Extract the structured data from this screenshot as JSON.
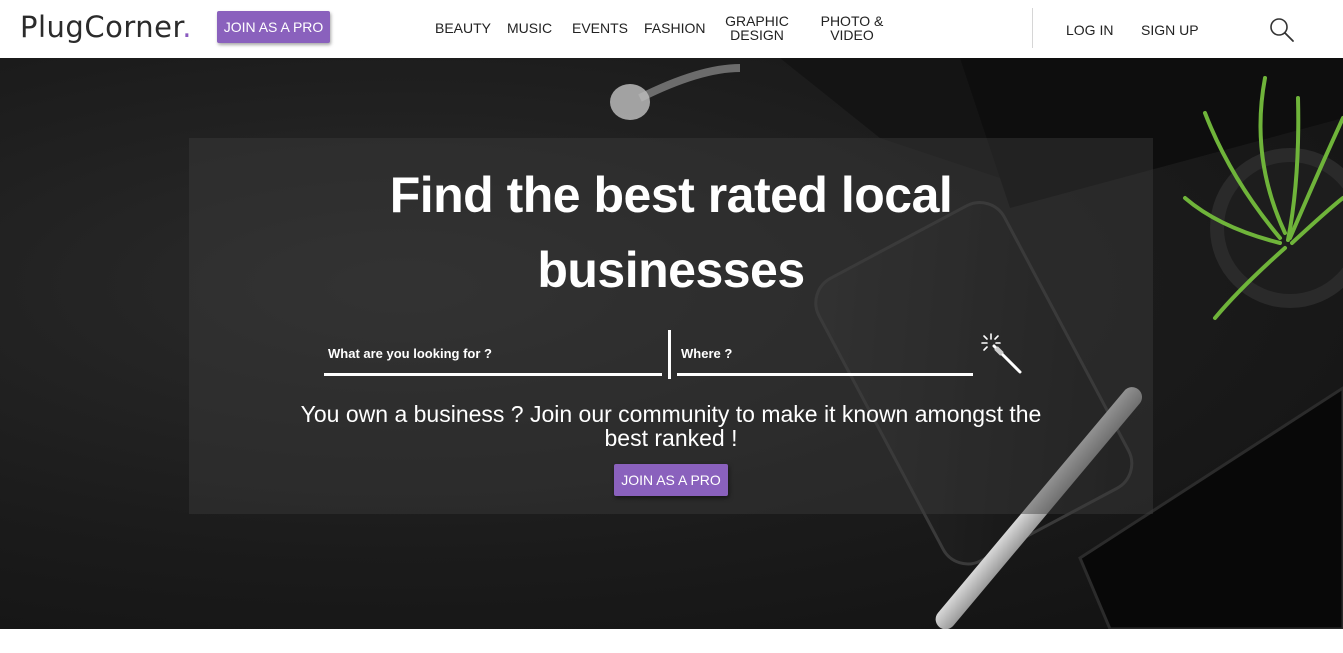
{
  "header": {
    "logo_text": "PlugCorner",
    "logo_dot": ".",
    "join_pro_label": "JOIN AS A PRO",
    "nav": [
      {
        "label": "BEAUTY"
      },
      {
        "label": "MUSIC"
      },
      {
        "label": "EVENTS"
      },
      {
        "label": "FASHION"
      },
      {
        "label_line1": "GRAPHIC",
        "label_line2": "DESIGN"
      },
      {
        "label_line1": "PHOTO &",
        "label_line2": "VIDEO"
      }
    ],
    "login_label": "LOG IN",
    "signup_label": "SIGN UP",
    "search_icon": "search-icon"
  },
  "hero": {
    "headline_line1": "Find the best rated local",
    "headline_line2": "businesses",
    "what_placeholder": "What are you looking for ?",
    "where_placeholder": "Where ?",
    "magic_icon": "magic-wand-icon",
    "own_line1": "You own a business ? Join our community to make it known amongst the",
    "own_line2": "best ranked !",
    "cta_label": "JOIN AS A PRO"
  },
  "colors": {
    "accent": "#8a61bd",
    "text_dark": "#222222",
    "hero_bg": "#1b1b1b"
  }
}
